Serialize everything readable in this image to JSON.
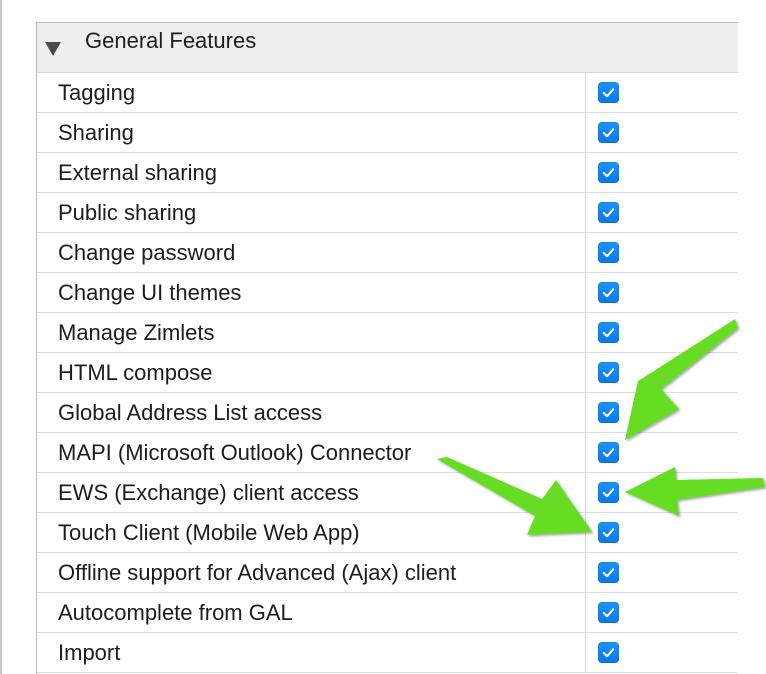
{
  "section": {
    "title": "General Features",
    "icon": "collapse-triangle-icon"
  },
  "features": [
    {
      "label": "Tagging",
      "checked": true
    },
    {
      "label": "Sharing",
      "checked": true
    },
    {
      "label": "External sharing",
      "checked": true
    },
    {
      "label": "Public sharing",
      "checked": true
    },
    {
      "label": "Change password",
      "checked": true
    },
    {
      "label": "Change UI themes",
      "checked": true
    },
    {
      "label": "Manage Zimlets",
      "checked": true
    },
    {
      "label": "HTML compose",
      "checked": true
    },
    {
      "label": "Global Address List access",
      "checked": true
    },
    {
      "label": "MAPI (Microsoft Outlook) Connector",
      "checked": true
    },
    {
      "label": "EWS (Exchange) client access",
      "checked": true
    },
    {
      "label": "Touch Client (Mobile Web App)",
      "checked": true
    },
    {
      "label": "Offline support for Advanced (Ajax) client",
      "checked": true
    },
    {
      "label": "Autocomplete from GAL",
      "checked": true
    },
    {
      "label": "Import",
      "checked": true
    }
  ],
  "colors": {
    "checkbox": "#0a82f5",
    "annotation_arrow": "#66dd22",
    "header_bg": "#efefef"
  }
}
